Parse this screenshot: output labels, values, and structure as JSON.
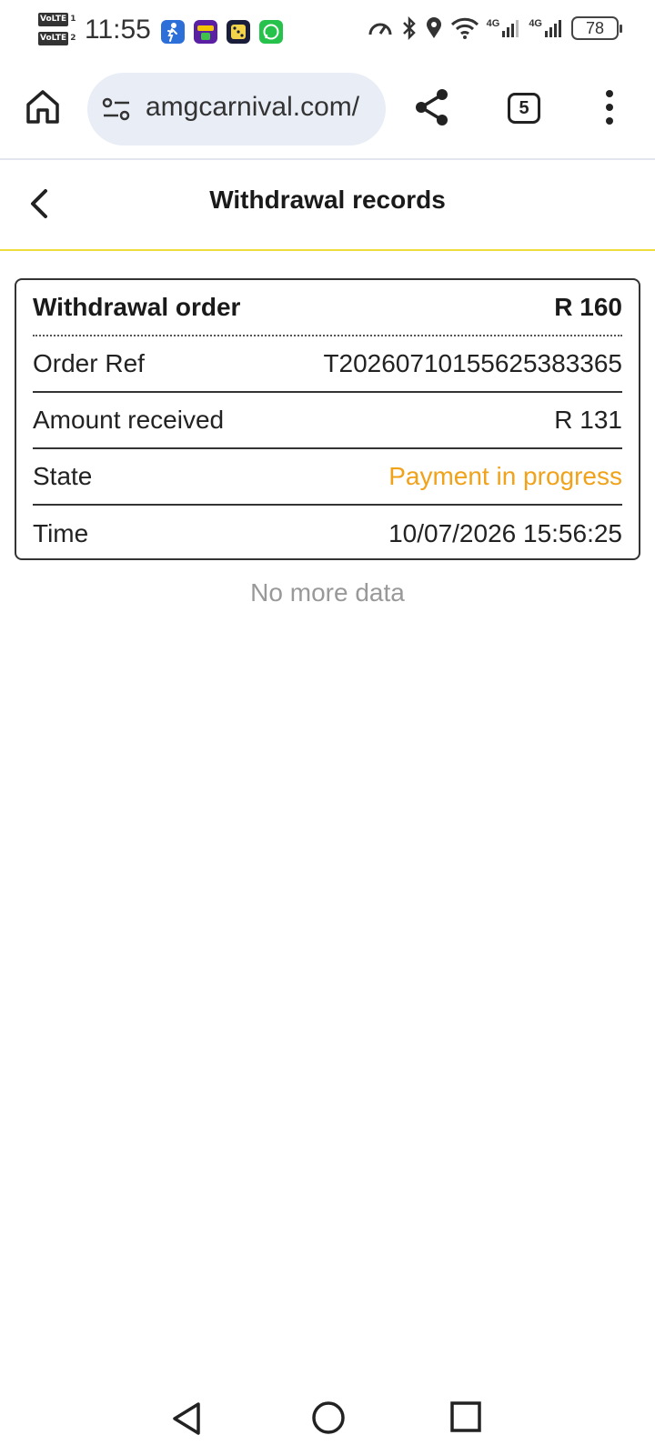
{
  "status_bar": {
    "sim1": "VoLTE",
    "sim1_slot": "1",
    "sim2": "VoLTE",
    "sim2_slot": "2",
    "time": "11:55",
    "network1": "4G",
    "network2": "4G",
    "battery": "78"
  },
  "browser": {
    "url": "amgcarnival.com/",
    "tab_count": "5"
  },
  "page": {
    "title": "Withdrawal records"
  },
  "record": {
    "header_label": "Withdrawal order",
    "header_amount": "R 160",
    "rows": [
      {
        "label": "Order Ref",
        "value": "T20260710155625383365"
      },
      {
        "label": "Amount received",
        "value": "R 131"
      },
      {
        "label": "State",
        "value": "Payment in progress"
      },
      {
        "label": "Time",
        "value": "10/07/2026 15:56:25"
      }
    ]
  },
  "footer": {
    "no_more": "No more data"
  },
  "colors": {
    "accent_yellow": "#f0dc3c",
    "state_orange": "#f0a21a",
    "url_pill_bg": "#e9edf6"
  }
}
